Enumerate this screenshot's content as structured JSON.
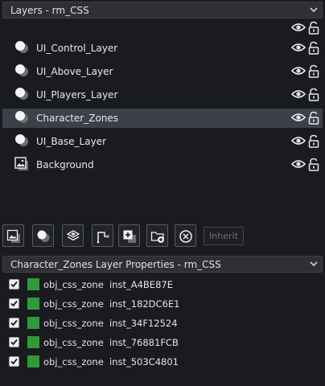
{
  "layers_panel": {
    "title": "Layers - rm_CSS",
    "layers": [
      {
        "name": "UI_Control_Layer",
        "icon": "instance-layer-icon",
        "selected": false
      },
      {
        "name": "UI_Above_Layer",
        "icon": "instance-layer-icon",
        "selected": false
      },
      {
        "name": "UI_Players_Layer",
        "icon": "instance-layer-icon",
        "selected": false
      },
      {
        "name": "Character_Zones",
        "icon": "instance-layer-icon",
        "selected": true
      },
      {
        "name": "UI_Base_Layer",
        "icon": "instance-layer-icon",
        "selected": false
      },
      {
        "name": "Background",
        "icon": "background-layer-icon",
        "selected": false
      }
    ]
  },
  "toolbar": {
    "buttons": [
      "add-background-layer-icon",
      "add-instance-layer-icon",
      "add-tile-layer-icon",
      "add-path-layer-icon",
      "add-asset-layer-icon",
      "add-folder-icon",
      "delete-layer-icon"
    ],
    "inherit_label": "Inherit"
  },
  "properties_panel": {
    "title": "Character_Zones Layer Properties - rm_CSS",
    "instances": [
      {
        "object": "obj_css_zone",
        "id": "inst_A4BE87E",
        "checked": true
      },
      {
        "object": "obj_css_zone",
        "id": "inst_182DC6E1",
        "checked": true
      },
      {
        "object": "obj_css_zone",
        "id": "inst_34F12524",
        "checked": true
      },
      {
        "object": "obj_css_zone",
        "id": "inst_76881FCB",
        "checked": true
      },
      {
        "object": "obj_css_zone",
        "id": "inst_503C4801",
        "checked": true
      }
    ]
  },
  "colors": {
    "background": "#1a1b1e",
    "header": "#2e3036",
    "selected_row": "#3b4049",
    "instance_swatch": "#2e9a3a"
  }
}
